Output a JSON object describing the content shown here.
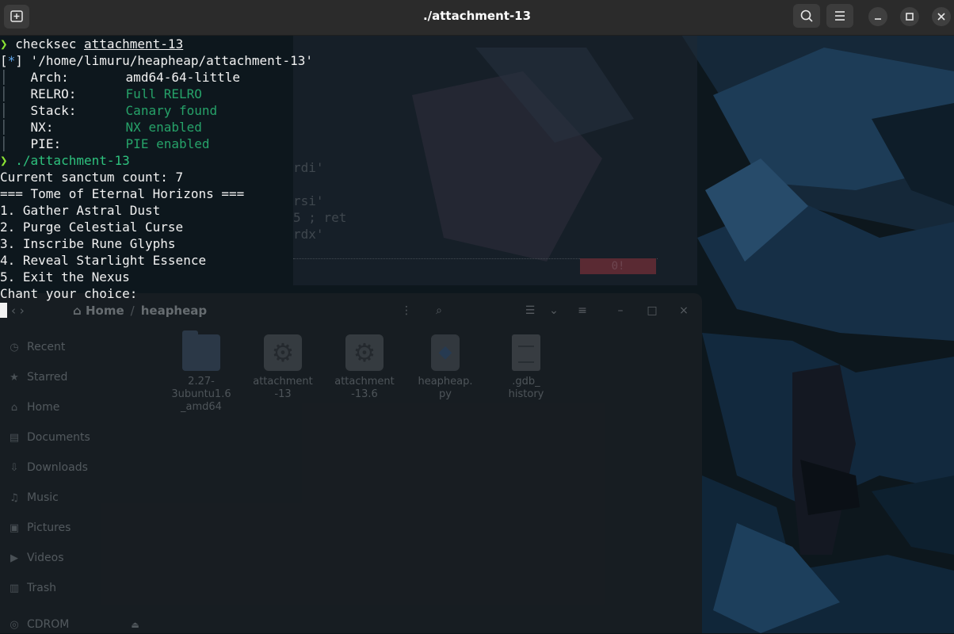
{
  "window": {
    "title": "./attachment-13"
  },
  "terminal": {
    "line1": {
      "cmd": "checksec",
      "arg": "attachment-13"
    },
    "line2": {
      "tag_open": "[",
      "tag_mark": "*",
      "tag_close": "]",
      "path": " '/home/limuru/heapheap/attachment-13'"
    },
    "checksec": [
      {
        "key": "Arch:",
        "value": "amd64-64-little"
      },
      {
        "key": "RELRO:",
        "value": "Full RELRO"
      },
      {
        "key": "Stack:",
        "value": "Canary found"
      },
      {
        "key": "NX:",
        "value": "NX enabled"
      },
      {
        "key": "PIE:",
        "value": "PIE enabled"
      }
    ],
    "run_cmd": "./attachment-13",
    "program_output": [
      "Current sanctum count: 7",
      "=== Tome of Eternal Horizons ===",
      "1. Gather Astral Dust",
      "2. Purge Celestial Curse",
      "3. Inscribe Rune Glyphs",
      "4. Reveal Starlight Essence",
      "5. Exit the Nexus",
      "Chant your choice:"
    ]
  },
  "ghost_terminal": {
    "lines": [
      "rdi'",
      "",
      "rsi'",
      "5 ; ret",
      "rdx'"
    ],
    "badge": "0!"
  },
  "file_manager": {
    "path": [
      "Home",
      "heapheap"
    ],
    "sidebar": [
      "Recent",
      "Starred",
      "Home",
      "Documents",
      "Downloads",
      "Music",
      "Pictures",
      "Videos",
      "Trash",
      "CDROM"
    ],
    "files": [
      {
        "name_line1": "2.27-",
        "name_line2": "3ubuntu1.6",
        "name_line3": "_amd64",
        "type": "folder"
      },
      {
        "name_line1": "attachment",
        "name_line2": "-13",
        "name_line3": "",
        "type": "exec"
      },
      {
        "name_line1": "attachment",
        "name_line2": "-13.6",
        "name_line3": "",
        "type": "exec"
      },
      {
        "name_line1": "heapheap.",
        "name_line2": "py",
        "name_line3": "",
        "type": "py"
      },
      {
        "name_line1": ".gdb_",
        "name_line2": "history",
        "name_line3": "",
        "type": "txt"
      }
    ]
  },
  "colors": {
    "prompt": "#8ae234",
    "info_tag": "#5fa4e8",
    "secure_green": "#26a269",
    "titlebar": "#2b2b2b"
  }
}
